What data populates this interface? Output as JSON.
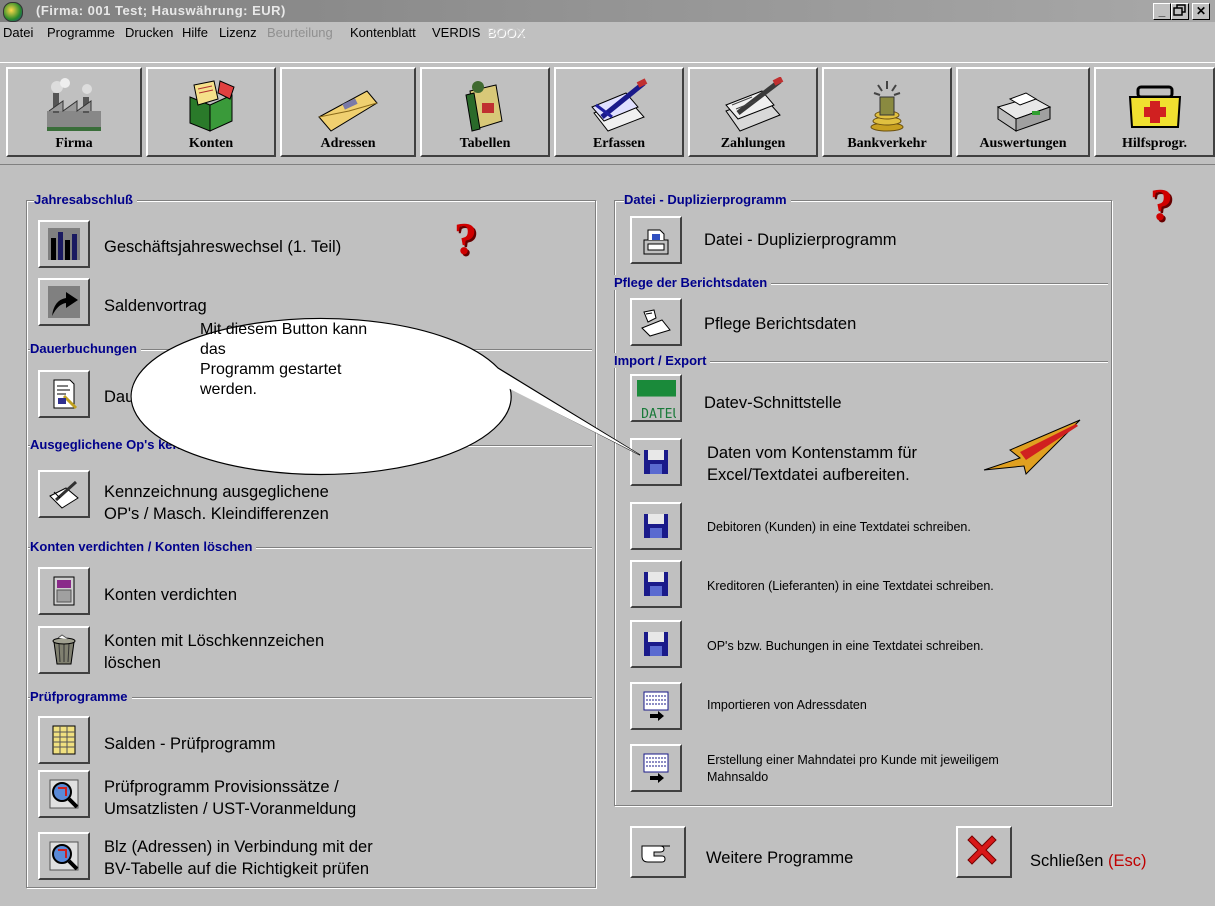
{
  "window": {
    "title": "(Firma: 001 Test;   Hauswährung: EUR)",
    "controls": [
      "_",
      "🗗",
      "✕"
    ]
  },
  "menu": [
    {
      "label": "Datei",
      "state": "normal"
    },
    {
      "label": "Programme",
      "state": "normal"
    },
    {
      "label": "Drucken",
      "state": "normal"
    },
    {
      "label": "Hilfe",
      "state": "normal"
    },
    {
      "label": "Lizenz",
      "state": "normal"
    },
    {
      "label": "Beurteilung",
      "state": "disabled"
    },
    {
      "label": "Kontenblatt",
      "state": "normal"
    },
    {
      "label": "VERDIS",
      "state": "normal"
    },
    {
      "label": "BOOX",
      "state": "disabled"
    }
  ],
  "toolbar": [
    {
      "label": "Firma",
      "icon": "factory-icon"
    },
    {
      "label": "Konten",
      "icon": "books-icon"
    },
    {
      "label": "Adressen",
      "icon": "envelope-icon"
    },
    {
      "label": "Tabellen",
      "icon": "ledger-icon"
    },
    {
      "label": "Erfassen",
      "icon": "pen-papers-icon"
    },
    {
      "label": "Zahlungen",
      "icon": "payment-icon"
    },
    {
      "label": "Bankverkehr",
      "icon": "bank-coins-icon"
    },
    {
      "label": "Auswertungen",
      "icon": "printer-icon"
    },
    {
      "label": "Hilfsprogr.",
      "icon": "first-aid-icon"
    }
  ],
  "left_panel": {
    "sections": [
      {
        "title": "Jahresabschluß",
        "items": [
          {
            "text": "Geschäftsjahreswechsel (1. Teil)",
            "icon": "bar-chart-icon"
          },
          {
            "text": "Saldenvortrag",
            "icon": "arrow-icon"
          }
        ]
      },
      {
        "title": "Dauerbuchungen",
        "items": [
          {
            "text": "Dauerbuchungen",
            "icon": "document-icon"
          }
        ]
      },
      {
        "title": "Ausgeglichene Op's kennzeichnen",
        "items": [
          {
            "text": "Kennzeichnung ausgeglichene\nOP's / Masch. Kleindifferenzen",
            "icon": "pen-paper-icon"
          }
        ]
      },
      {
        "title": "Konten verdichten / Konten löschen",
        "items": [
          {
            "text": "Konten verdichten",
            "icon": "compress-icon"
          },
          {
            "text": "Konten mit Löschkennzeichen\nlöschen",
            "icon": "trash-icon"
          }
        ]
      },
      {
        "title": "Prüfprogramme",
        "items": [
          {
            "text": "Salden - Prüfprogramm",
            "icon": "spreadsheet-icon"
          },
          {
            "text": "Prüfprogramm Provisionssätze /\nUmsatzlisten / UST-Voranmeldung",
            "icon": "magnifier-icon"
          },
          {
            "text": "Blz (Adressen) in Verbindung mit der\nBV-Tabelle auf die Richtigkeit prüfen",
            "icon": "magnifier-icon"
          }
        ]
      }
    ]
  },
  "right_panel": {
    "sections": [
      {
        "title": "Datei - Duplizierprogramm",
        "items": [
          {
            "text": "Datei - Duplizierprogramm",
            "icon": "copy-icon",
            "small": false
          }
        ]
      },
      {
        "title": "Pflege der Berichtsdaten",
        "items": [
          {
            "text": "Pflege Berichtsdaten",
            "icon": "hand-paper-icon",
            "small": false
          }
        ]
      },
      {
        "title": "Import / Export",
        "items": [
          {
            "text": "Datev-Schnittstelle",
            "icon": "datev-icon",
            "badge": "DATEU",
            "small": false
          },
          {
            "text": "Daten vom Kontenstamm für\nExcel/Textdatei aufbereiten.",
            "icon": "floppy-icon",
            "small": false
          },
          {
            "text": "Debitoren (Kunden) in eine Textdatei schreiben.",
            "icon": "floppy-icon",
            "small": true
          },
          {
            "text": "Kreditoren (Lieferanten) in eine Textdatei schreiben.",
            "icon": "floppy-icon",
            "small": true
          },
          {
            "text": "OP's bzw. Buchungen in eine Textdatei schreiben.",
            "icon": "floppy-icon",
            "small": true
          },
          {
            "text": "Importieren von Adressdaten",
            "icon": "import-icon",
            "small": true
          },
          {
            "text": "Erstellung einer Mahndatei pro Kunde mit jeweiligem\nMahnsaldo",
            "icon": "import-icon",
            "small": true
          }
        ]
      }
    ]
  },
  "footer": {
    "more_label": "Weitere Programme",
    "close_label": "Schließen",
    "close_shortcut": "(Esc)"
  },
  "help_mark": "?",
  "callout": {
    "text_lines": [
      "Mit diesem Button kann",
      "das",
      "Programm gestartet",
      "werden."
    ]
  },
  "colors": {
    "section_title": "#00008b",
    "help_mark": "#d00000",
    "esc": "#c00000"
  }
}
